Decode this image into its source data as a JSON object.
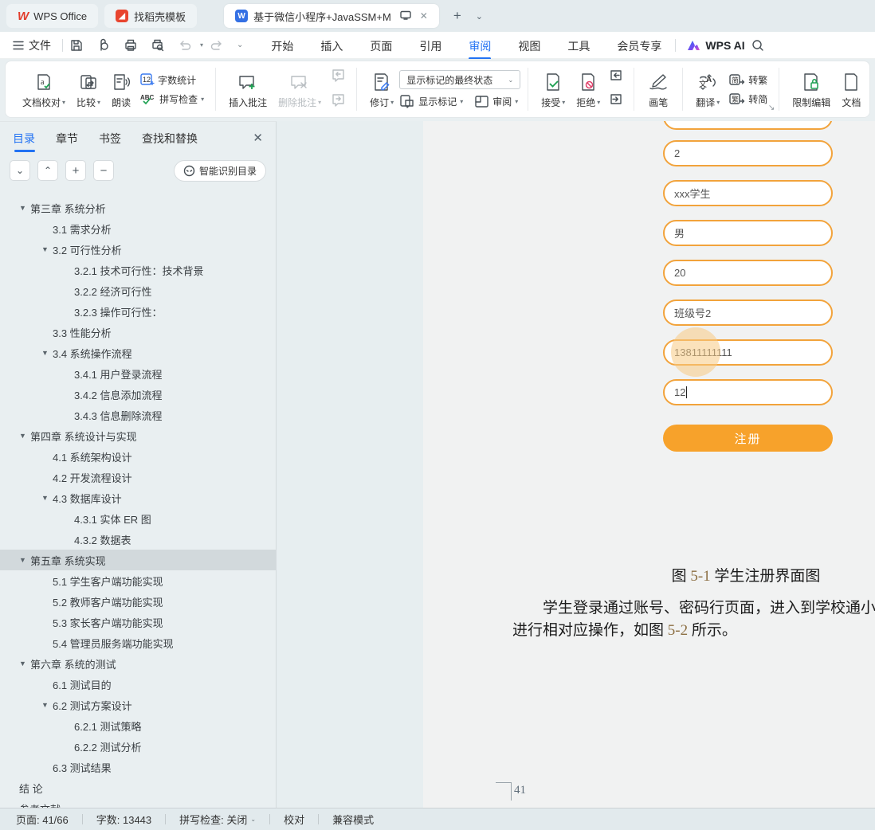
{
  "colors": {
    "accent_blue": "#2272f3",
    "brand_red": "#e23d2c",
    "field_orange": "#f2a33b",
    "button_orange": "#f7a22b",
    "selected_row": "#d2d9dc"
  },
  "titlebar": {
    "home_tab": "WPS Office",
    "template_tab": "找稻壳模板",
    "doc_tab": "基于微信小程序+JavaSSM+M",
    "new_tab_icon": "+",
    "tabs_dropdown_icon": "⌄"
  },
  "menubar": {
    "file": "文件",
    "items": [
      "开始",
      "插入",
      "页面",
      "引用",
      "审阅",
      "视图",
      "工具",
      "会员专享"
    ],
    "active_item": "审阅",
    "wps_ai": "WPS AI"
  },
  "ribbon": {
    "proofread": "文档校对",
    "compare": "比较",
    "read_aloud": "朗读",
    "word_count": "字数统计",
    "spell_check": "拼写检查",
    "insert_comment": "插入批注",
    "delete_comment": "删除批注",
    "track_changes": "修订",
    "markup_state_select": "显示标记的最终状态",
    "show_markup": "显示标记",
    "review_pane": "审阅",
    "accept": "接受",
    "reject": "拒绝",
    "pen": "画笔",
    "translate": "翻译",
    "to_traditional": "转繁",
    "to_simplified": "转简",
    "restrict_edit": "限制编辑",
    "doc_partial": "文档"
  },
  "sidebar": {
    "tabs": [
      "目录",
      "章节",
      "书签",
      "查找和替换"
    ],
    "active_tab": "目录",
    "smart_button": "智能识别目录",
    "toc": [
      {
        "label": "第三章 系统分析",
        "level": 1,
        "caret": true
      },
      {
        "label": "3.1 需求分析",
        "level": 2,
        "caret": false
      },
      {
        "label": "3.2 可行性分析",
        "level": 2,
        "caret": true
      },
      {
        "label": "3.2.1 技术可行性：技术背景",
        "level": 3,
        "caret": false
      },
      {
        "label": "3.2.2 经济可行性",
        "level": 3,
        "caret": false
      },
      {
        "label": "3.2.3 操作可行性：",
        "level": 3,
        "caret": false
      },
      {
        "label": "3.3 性能分析",
        "level": 2,
        "caret": false
      },
      {
        "label": "3.4 系统操作流程",
        "level": 2,
        "caret": true
      },
      {
        "label": "3.4.1 用户登录流程",
        "level": 3,
        "caret": false
      },
      {
        "label": "3.4.2 信息添加流程",
        "level": 3,
        "caret": false
      },
      {
        "label": "3.4.3 信息删除流程",
        "level": 3,
        "caret": false
      },
      {
        "label": "第四章 系统设计与实现",
        "level": 1,
        "caret": true
      },
      {
        "label": "4.1 系统架构设计",
        "level": 2,
        "caret": false
      },
      {
        "label": "4.2 开发流程设计",
        "level": 2,
        "caret": false
      },
      {
        "label": "4.3 数据库设计",
        "level": 2,
        "caret": true
      },
      {
        "label": "4.3.1 实体 ER 图",
        "level": 3,
        "caret": false
      },
      {
        "label": "4.3.2 数据表",
        "level": 3,
        "caret": false
      },
      {
        "label": "第五章 系统实现",
        "level": 1,
        "caret": true,
        "selected": true
      },
      {
        "label": "5.1 学生客户端功能实现",
        "level": 2,
        "caret": false
      },
      {
        "label": "5.2 教师客户端功能实现",
        "level": 2,
        "caret": false
      },
      {
        "label": "5.3 家长客户端功能实现",
        "level": 2,
        "caret": false
      },
      {
        "label": "5.4 管理员服务端功能实现",
        "level": 2,
        "caret": false
      },
      {
        "label": "第六章  系统的测试",
        "level": 1,
        "caret": true
      },
      {
        "label": "6.1 测试目的",
        "level": 2,
        "caret": false
      },
      {
        "label": "6.2 测试方案设计",
        "level": 2,
        "caret": true
      },
      {
        "label": "6.2.1 测试策略",
        "level": 3,
        "caret": false
      },
      {
        "label": "6.2.2 测试分析",
        "level": 3,
        "caret": false
      },
      {
        "label": "6.3 测试结果",
        "level": 2,
        "caret": false
      },
      {
        "label": "结  论",
        "level": 1,
        "caret": false
      },
      {
        "label": "参考文献",
        "level": 1,
        "caret": false
      }
    ]
  },
  "document": {
    "form_fields": [
      {
        "value": "",
        "partial": true
      },
      {
        "value": "2"
      },
      {
        "value": "xxx学生"
      },
      {
        "value": "男"
      },
      {
        "value": "20"
      },
      {
        "value": "班级号2"
      },
      {
        "value": "13811111111",
        "highlight": true
      },
      {
        "value": "12",
        "cursor": true
      }
    ],
    "register_button": "注册",
    "caption": {
      "prefix": "图 ",
      "num": "5-1",
      "suffix": " 学生注册界面图"
    },
    "para_line1": "学生登录通过账号、密码行页面，进入到学校通小程序主界面",
    "para_line2_pre": "进行相对应操作，如图 ",
    "para_line2_num": "5-2",
    "para_line2_post": " 所示。",
    "page_number": "41"
  },
  "statusbar": {
    "page": "页面: 41/66",
    "words": "字数: 13443",
    "spell": "拼写检查: 关闭",
    "proof": "校对",
    "mode": "兼容模式"
  }
}
